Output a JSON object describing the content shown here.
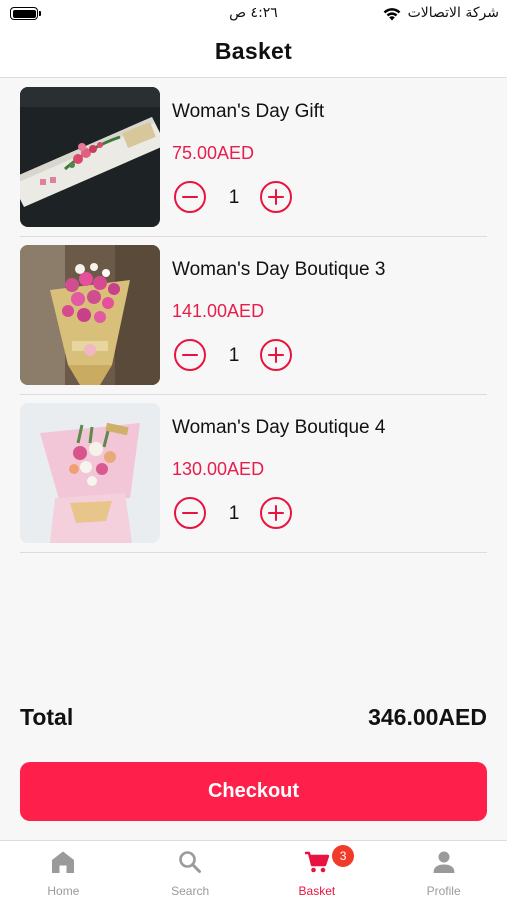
{
  "status_bar": {
    "time": "٤:٢٦ ص",
    "carrier": "شركة الاتصالات"
  },
  "header": {
    "title": "Basket"
  },
  "basket": {
    "items": [
      {
        "name": "Woman's Day Gift",
        "price": "75.00AED",
        "quantity": "1"
      },
      {
        "name": "Woman's Day Boutique 3",
        "price": "141.00AED",
        "quantity": "1"
      },
      {
        "name": "Woman's Day Boutique 4",
        "price": "130.00AED",
        "quantity": "1"
      }
    ]
  },
  "summary": {
    "total_label": "Total",
    "total_value": "346.00AED"
  },
  "checkout": {
    "label": "Checkout"
  },
  "tabbar": {
    "tabs": [
      {
        "label": "Home",
        "icon": "home-icon"
      },
      {
        "label": "Search",
        "icon": "search-icon"
      },
      {
        "label": "Basket",
        "icon": "cart-icon",
        "badge": "3"
      },
      {
        "label": "Profile",
        "icon": "profile-icon"
      }
    ],
    "active": "Basket"
  },
  "colors": {
    "accent": "#ff1f4b",
    "price": "#e61e4d",
    "inactive_tab": "#9a9a9a",
    "background": "#f7f7f7"
  }
}
